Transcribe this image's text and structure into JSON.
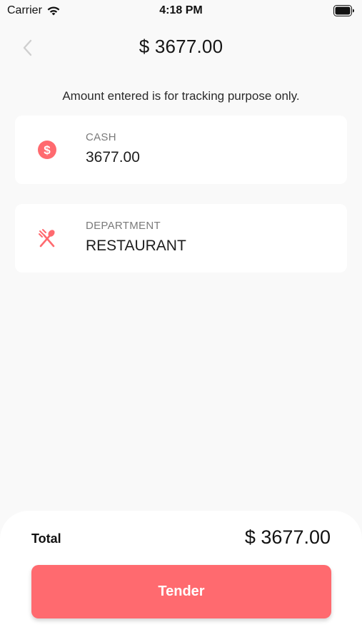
{
  "status_bar": {
    "carrier": "Carrier",
    "time": "4:18 PM",
    "wifi_icon": "wifi-icon",
    "battery_icon": "battery-icon"
  },
  "header": {
    "back_icon": "chevron-left-icon",
    "title": "$ 3677.00"
  },
  "notice": "Amount entered is for tracking purpose only.",
  "cards": [
    {
      "icon": "dollar-circle-icon",
      "label": "CASH",
      "value": "3677.00"
    },
    {
      "icon": "fork-spoon-icon",
      "label": "DEPARTMENT",
      "value": "RESTAURANT"
    }
  ],
  "footer": {
    "total_label": "Total",
    "total_value": "$ 3677.00",
    "tender_label": "Tender"
  },
  "colors": {
    "accent": "#ff6a6f",
    "background": "#f9f9f9",
    "card": "#ffffff"
  }
}
